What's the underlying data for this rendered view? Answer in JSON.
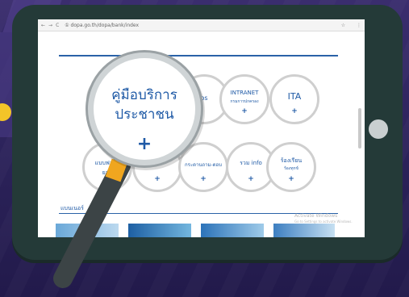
{
  "browser": {
    "nav": [
      "←",
      "→",
      "C"
    ],
    "url": "① dopa.go.th/dopa/bank/index",
    "star_icon": "☆",
    "menu_icon": "⋮"
  },
  "circles": [
    {
      "title": "",
      "plus": ""
    },
    {
      "title": "os",
      "plus": ""
    },
    {
      "title": "INTRANET",
      "subtitle": "กรมการปกครอง",
      "plus": "+"
    },
    {
      "title": "ITA",
      "plus": "+"
    },
    {
      "title": "แบบฟอร์ม",
      "subtitle": "ยอดิ",
      "plus": ""
    },
    {
      "title": "",
      "plus": "+"
    },
    {
      "title": "กระดานถาม-ตอบ",
      "plus": "+"
    },
    {
      "title": "รวม info",
      "plus": "+"
    },
    {
      "title": "ร้องเรียน",
      "subtitle": "ร้องทุกข์",
      "plus": "+"
    }
  ],
  "magnifier": {
    "title_line1": "คู่มือบริการ",
    "title_line2": "ประชาชน",
    "plus": "+"
  },
  "banner": {
    "label": "แบนเนอร์",
    "watermark_line1": "Activate Windows",
    "watermark_line2": "Go to Settings to activate Windows."
  },
  "colors": {
    "background": "#2b2259",
    "tablet": "#243a38",
    "accent_blue": "#1f5aa6",
    "highlight_yellow": "#f3c428",
    "handle_orange": "#f0a61f"
  }
}
